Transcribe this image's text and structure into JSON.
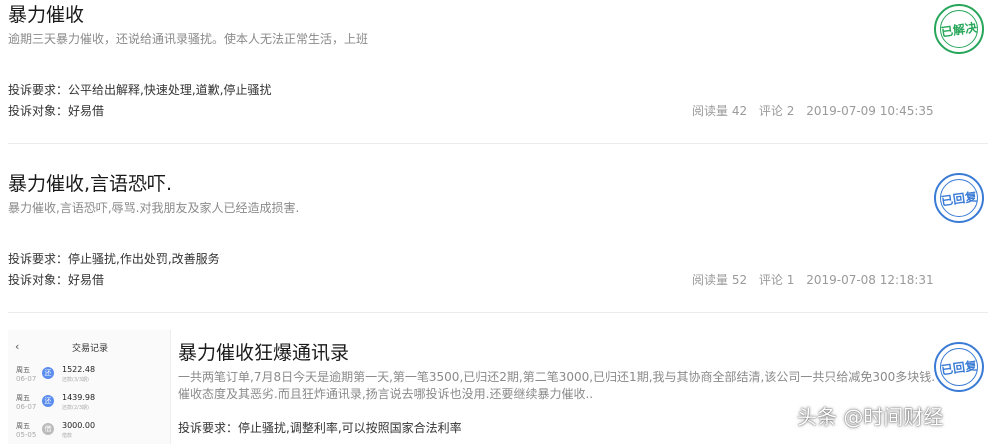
{
  "complaints": [
    {
      "title": "暴力催收",
      "description": "逾期三天暴力催收，还说给通讯录骚扰。使本人无法正常生活，上班",
      "requirement": "投诉要求：公平给出解释,快速处理,道歉,停止骚扰",
      "target": "投诉对象：好易借",
      "read_count": "阅读量 42",
      "comment_count": "评论 2",
      "time": "2019-07-09 10:45:35",
      "status": "已解决",
      "status_color": "#27a65a"
    },
    {
      "title": "暴力催收,言语恐吓.",
      "description": "暴力催收,言语恐吓,辱骂.对我朋友及家人已经造成损害.",
      "requirement": "投诉要求：停止骚扰,作出处罚,改善服务",
      "target": "投诉对象：好易借",
      "read_count": "阅读量 52",
      "comment_count": "评论 1",
      "time": "2019-07-08 12:18:31",
      "status": "已回复",
      "status_color": "#3a7bd5"
    },
    {
      "title": "暴力催收狂爆通讯录",
      "description_line1": "一共两笔订单,7月8日今天是逾期第一天,第一笔3500,已归还2期,第二笔3000,已归还1期,我与其协商全部结清,该公司一共只给减免300多块钱.",
      "description_line2": "催收态度及其恶劣.而且狂炸通讯录,扬言说去哪投诉也没用.还要继续暴力催收..",
      "requirement": "投诉要求：停止骚扰,调整利率,可以按照国家合法利率",
      "status": "已回复",
      "status_color": "#3a7bd5",
      "thumbnail": {
        "back_icon": "chevron-left-icon",
        "header": "交易记录",
        "rows": [
          {
            "day": "周五",
            "date": "06-07",
            "badge": "还",
            "amount": "1522.48",
            "sub": "还款(3/3期)"
          },
          {
            "day": "周五",
            "date": "06-07",
            "badge": "还",
            "amount": "1439.98",
            "sub": "还款(2/3期)"
          },
          {
            "day": "周五",
            "date": "05-05",
            "badge": "借",
            "amount": "3000.00",
            "sub": "借款"
          }
        ]
      }
    }
  ],
  "watermark": "头条 @时间财经"
}
